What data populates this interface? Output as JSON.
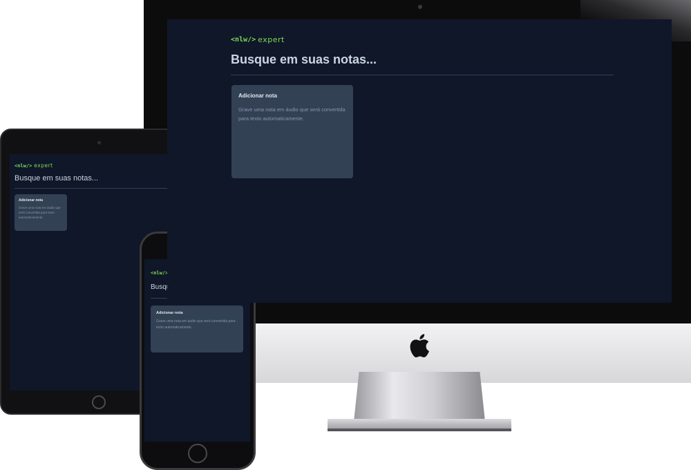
{
  "app": {
    "logo": {
      "tag": "<nlw/>",
      "word": "expert",
      "accent_color": "#7ed957"
    },
    "search": {
      "placeholder": "Busque em suas notas..."
    },
    "add_note_card": {
      "title": "Adicionar nota",
      "description": "Grave uma nota em áudio que será convertida para texto automaticamente."
    },
    "colors": {
      "background": "#0f1729",
      "card": "#334155",
      "divider": "#334155"
    }
  },
  "devices": {
    "desktop_brand_icon": "apple-logo-icon"
  }
}
